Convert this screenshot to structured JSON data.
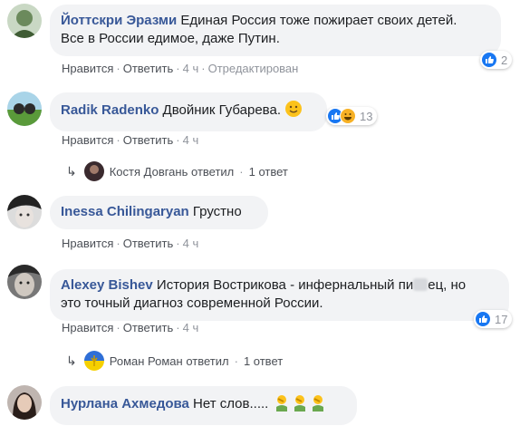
{
  "actions": {
    "like": "Нравится",
    "reply": "Ответить",
    "separator": "·"
  },
  "comments": [
    {
      "author": "Йоттскри Эразми",
      "text_line1": "Единая Россия тоже пожирает своих детей.",
      "text_line2": "Все в России едимое, даже Путин.",
      "time": "4 ч",
      "edited": "Отредактирован",
      "reactions": {
        "types": [
          "like"
        ],
        "count": "2"
      }
    },
    {
      "author": "Radik Radenko",
      "text": "Двойник Губарева.",
      "time": "4 ч",
      "reactions": {
        "types": [
          "like",
          "haha"
        ],
        "count": "13"
      },
      "reply_summary": {
        "name": "Костя Довгань",
        "verb": "ответил",
        "count": "1 ответ"
      }
    },
    {
      "author": "Inessa Chilingaryan",
      "text": "Грустно",
      "time": "4 ч"
    },
    {
      "author": "Alexey Bishev",
      "text_line1_a": "История Вострикова - инфернальный пи",
      "text_line1_b": "ец, но",
      "text_line2": "это точный диагноз современной России.",
      "time": "4 ч",
      "reactions": {
        "types": [
          "like"
        ],
        "count": "17"
      },
      "reply_summary": {
        "name": "Роман Роман",
        "verb": "ответил",
        "count": "1 ответ"
      }
    },
    {
      "author": "Нурлана Ахмедова",
      "text": "Нет слов.....",
      "emoji_names": [
        "man-facepalming",
        "man-facepalming",
        "man-facepalming"
      ]
    }
  ],
  "colors": {
    "author": "#385898",
    "bubble": "#f2f3f5",
    "like_blue": "#1877f2",
    "muted": "#90949c"
  }
}
